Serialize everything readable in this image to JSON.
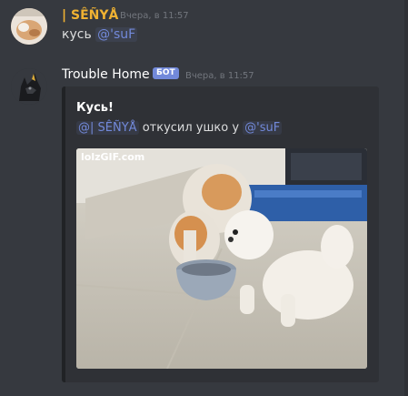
{
  "messages": [
    {
      "author": "| SÊÑYÅ",
      "author_color": "#f0b232",
      "timestamp": "Вчера, в 11:57",
      "text_prefix": "кусь",
      "mention": "@'suF"
    },
    {
      "author": "Trouble Home",
      "author_color": "#ffffff",
      "bot_tag": "БОТ",
      "timestamp": "Вчера, в 11:57",
      "embed": {
        "title": "Кусь!",
        "mention_1": "@| SÊÑYÅ",
        "desc_middle": "откусил ушко у",
        "mention_2": "@'suF",
        "gif_watermark": "lolzGIF.com"
      }
    }
  ],
  "colors": {
    "background": "#36393f",
    "embed_bg": "#2f3136",
    "mention": "#7289da"
  }
}
